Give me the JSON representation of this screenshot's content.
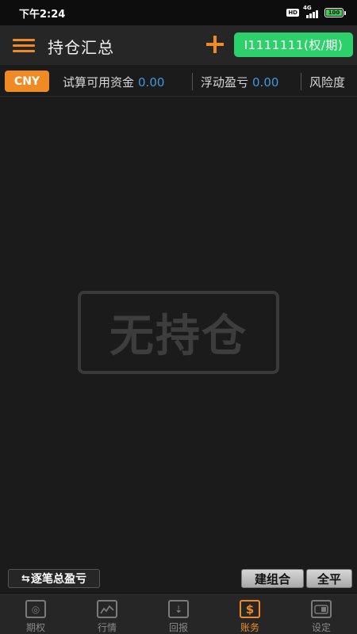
{
  "status_bar": {
    "time": "下午2:24",
    "hd": "HD",
    "network": "4G",
    "battery": "100"
  },
  "header": {
    "title": "持仓汇总",
    "account": "I1111111(权/期)"
  },
  "info_bar": {
    "currency": "CNY",
    "items": [
      {
        "label": "试算可用资金",
        "value": "0.00"
      },
      {
        "label": "浮动盈亏",
        "value": "0.00"
      },
      {
        "label": "风险度",
        "value": ""
      }
    ]
  },
  "empty_state": {
    "text": "无持仓"
  },
  "actions": {
    "toggle_label": "逐笔总盈亏",
    "toggle_icon": "swap-arrows-icon",
    "build_combo": "建组合",
    "close_all": "全平"
  },
  "tabs": [
    {
      "label": "期权",
      "icon": "target-icon",
      "active": false
    },
    {
      "label": "行情",
      "icon": "chart-icon",
      "active": false
    },
    {
      "label": "回报",
      "icon": "download-icon",
      "active": false
    },
    {
      "label": "账务",
      "icon": "dollar-icon",
      "active": true
    },
    {
      "label": "设定",
      "icon": "toggle-icon",
      "active": false
    }
  ],
  "colors": {
    "accent": "#f08a24",
    "account_green": "#2ed06b",
    "value_blue": "#3a9bdc",
    "background": "#1b1b1b"
  }
}
